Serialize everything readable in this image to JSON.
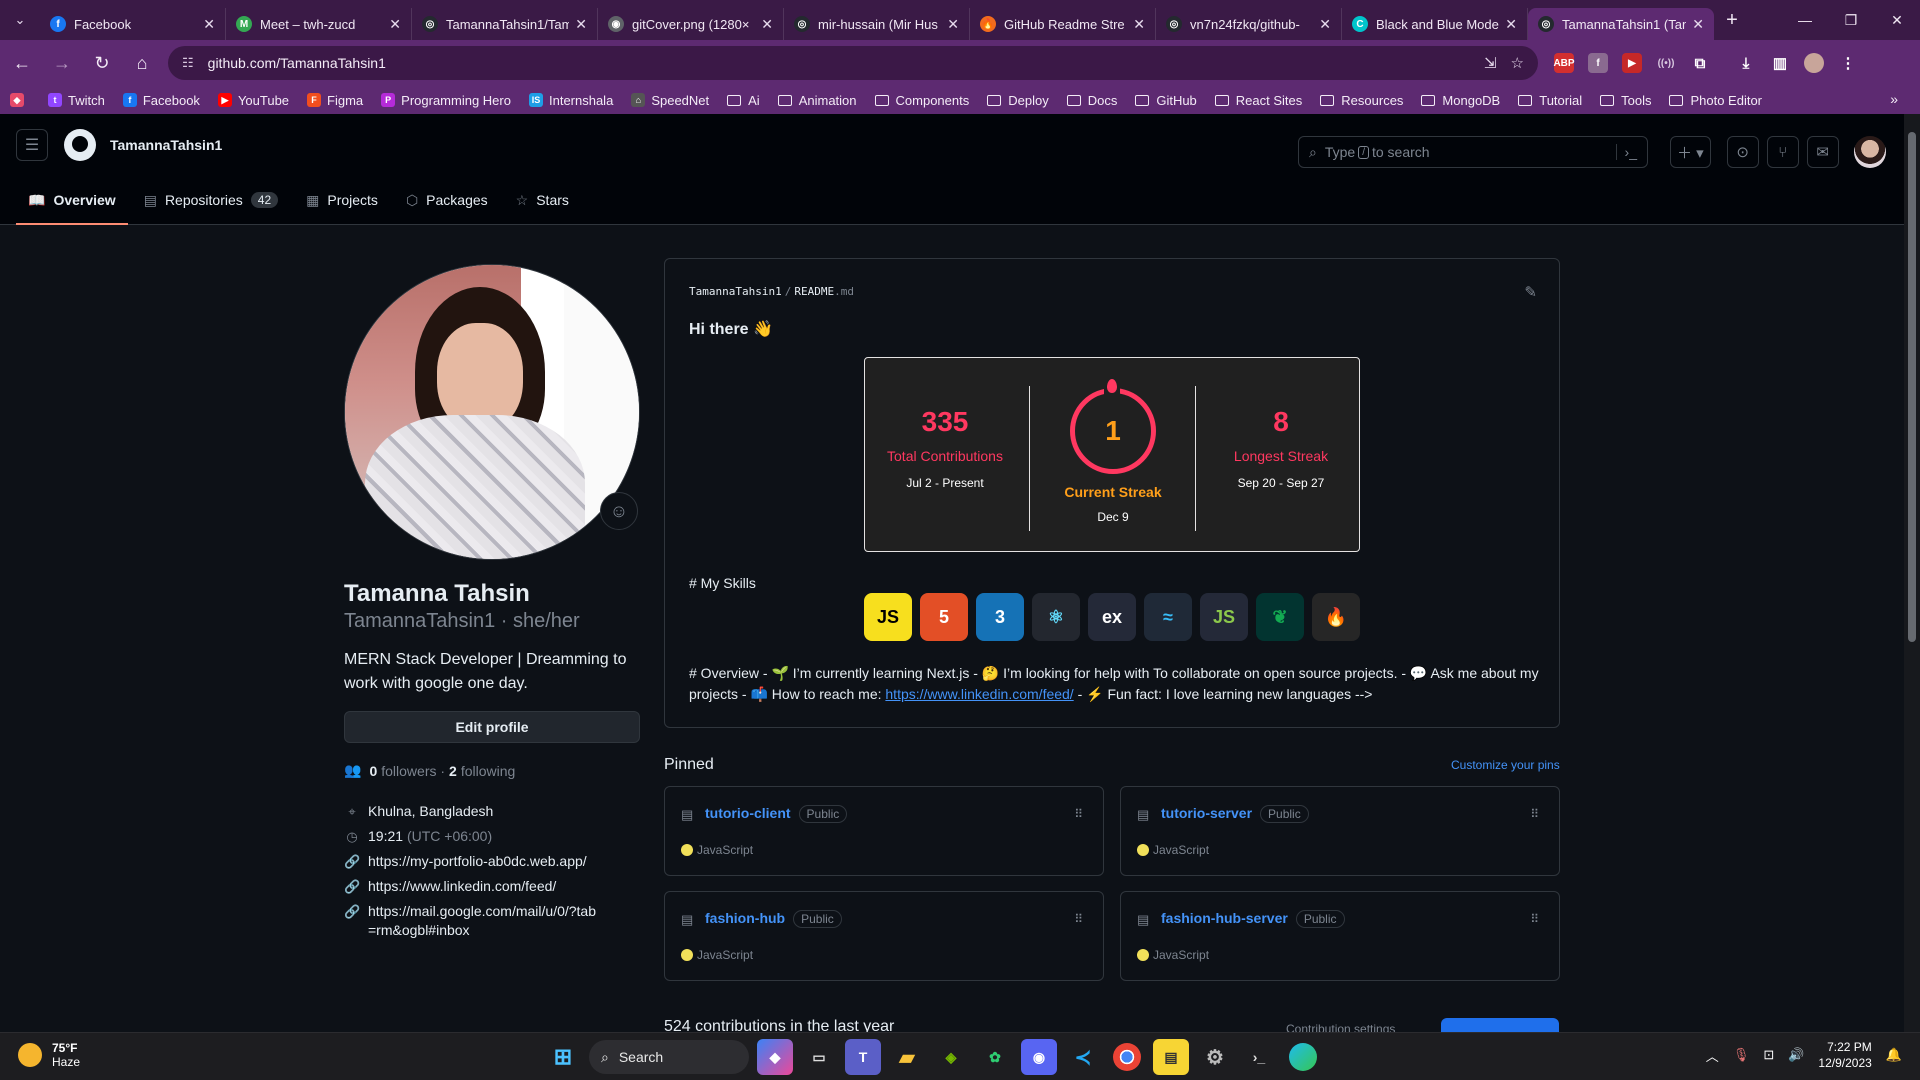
{
  "browser": {
    "tabs": [
      {
        "title": "Facebook",
        "color": "#1877f2",
        "glyph": "f"
      },
      {
        "title": "Meet – twh-zucd",
        "color": "#34a853",
        "glyph": "M"
      },
      {
        "title": "TamannaTahsin1/Tam",
        "color": "#24292f",
        "glyph": "◎"
      },
      {
        "title": "gitCover.png (1280×",
        "color": "#5f6368",
        "glyph": "◉"
      },
      {
        "title": "mir-hussain (Mir Hus",
        "color": "#24292f",
        "glyph": "◎"
      },
      {
        "title": "GitHub Readme Stre",
        "color": "#f26b1d",
        "glyph": "🔥"
      },
      {
        "title": "vn7n24fzkq/github-",
        "color": "#24292f",
        "glyph": "◎"
      },
      {
        "title": "Black and Blue Mode",
        "color": "#00c4cc",
        "glyph": "C"
      },
      {
        "title": "TamannaTahsin1 (Tam",
        "color": "#24292f",
        "glyph": "◎"
      }
    ],
    "url": "github.com/TamannaTahsin1",
    "bookmarks": [
      {
        "label": "Twitch",
        "type": "site",
        "color": "#9146ff",
        "glyph": "t"
      },
      {
        "label": "Facebook",
        "type": "site",
        "color": "#1877f2",
        "glyph": "f"
      },
      {
        "label": "YouTube",
        "type": "site",
        "color": "#ff0000",
        "glyph": "▶"
      },
      {
        "label": "Figma",
        "type": "site",
        "color": "#f24e1e",
        "glyph": "F"
      },
      {
        "label": "Programming Hero",
        "type": "site",
        "color": "#b52bd8",
        "glyph": "P"
      },
      {
        "label": "Internshala",
        "type": "site",
        "color": "#1e9ee6",
        "glyph": "IS"
      },
      {
        "label": "SpeedNet",
        "type": "site",
        "color": "#555555",
        "glyph": "⌂"
      },
      {
        "label": "Ai",
        "type": "folder"
      },
      {
        "label": "Animation",
        "type": "folder"
      },
      {
        "label": "Components",
        "type": "folder"
      },
      {
        "label": "Deploy",
        "type": "folder"
      },
      {
        "label": "Docs",
        "type": "folder"
      },
      {
        "label": "GitHub",
        "type": "folder"
      },
      {
        "label": "React Sites",
        "type": "folder"
      },
      {
        "label": "Resources",
        "type": "folder"
      },
      {
        "label": "MongoDB",
        "type": "folder"
      },
      {
        "label": "Tutorial",
        "type": "folder"
      },
      {
        "label": "Tools",
        "type": "folder"
      },
      {
        "label": "Photo Editor",
        "type": "folder"
      }
    ]
  },
  "github": {
    "username": "TamannaTahsin1",
    "search_placeholder_before": "Type",
    "search_key": "/",
    "search_placeholder_after": "to search",
    "tabs": [
      {
        "label": "Overview",
        "icon": "book-icon",
        "glyph": "📖"
      },
      {
        "label": "Repositories",
        "icon": "repo-icon",
        "glyph": "▤",
        "count": "42"
      },
      {
        "label": "Projects",
        "icon": "table-icon",
        "glyph": "▦"
      },
      {
        "label": "Packages",
        "icon": "package-icon",
        "glyph": "⬡"
      },
      {
        "label": "Stars",
        "icon": "star-icon",
        "glyph": "☆"
      }
    ]
  },
  "profile": {
    "name": "Tamanna Tahsin",
    "login_pronouns": "TamannaTahsin1 · she/her",
    "bio": "MERN Stack Developer | Dreamming to work with google one day.",
    "edit_label": "Edit profile",
    "followers": "0",
    "followers_label": "followers ·",
    "following": "2",
    "following_label": "following",
    "location": "Khulna, Bangladesh",
    "time": "19:21",
    "timezone": "(UTC +06:00)",
    "links": [
      "https://my-portfolio-ab0dc.web.app/",
      "https://www.linkedin.com/feed/",
      "https://mail.google.com/mail/u/0/?tab=rm&ogbl#inbox"
    ]
  },
  "readme": {
    "owner": "TamannaTahsin1",
    "separator": "/",
    "file_name": "README",
    "file_ext": ".md",
    "greeting": "Hi there 👋",
    "streak": {
      "total": "335",
      "total_label": "Total Contributions",
      "total_range": "Jul 2 - Present",
      "current": "1",
      "current_label": "Current Streak",
      "current_range": "Dec 9",
      "longest": "8",
      "longest_label": "Longest Streak",
      "longest_range": "Sep 20 - Sep 27",
      "colors": {
        "background": "#202020",
        "accent": "#ff3860",
        "current": "#ff9f1a"
      }
    },
    "skills_heading": "# My Skills",
    "skills": [
      {
        "name": "JavaScript",
        "text": "JS",
        "bg": "#f7df1e",
        "fg": "#000000",
        "icon": "javascript-icon"
      },
      {
        "name": "HTML5",
        "text": "5",
        "bg": "#e34f26",
        "fg": "#ffffff",
        "icon": "html5-icon"
      },
      {
        "name": "CSS3",
        "text": "3",
        "bg": "#1572b6",
        "fg": "#ffffff",
        "icon": "css3-icon"
      },
      {
        "name": "React",
        "text": "⚛",
        "bg": "#23272f",
        "fg": "#61dafb",
        "icon": "react-icon"
      },
      {
        "name": "Express",
        "text": "ex",
        "bg": "#242938",
        "fg": "#ffffff",
        "icon": "express-icon"
      },
      {
        "name": "Tailwind",
        "text": "≈",
        "bg": "#1f2937",
        "fg": "#38bdf8",
        "icon": "tailwind-icon"
      },
      {
        "name": "Node.js",
        "text": "JS",
        "bg": "#242938",
        "fg": "#8cc84b",
        "icon": "nodejs-icon"
      },
      {
        "name": "MongoDB",
        "text": "❦",
        "bg": "#023430",
        "fg": "#13aa52",
        "icon": "mongodb-icon"
      },
      {
        "name": "Firebase",
        "text": "🔥",
        "bg": "#262626",
        "fg": "#ffca28",
        "icon": "firebase-icon"
      }
    ],
    "overview_before": "# Overview - 🌱 I’m currently learning Next.js - 🤔 I’m looking for help with To collaborate on open source projects. - 💬 Ask me about my projects - 📫 How to reach me:",
    "overview_link": "https://www.linkedin.com/feed/",
    "overview_after": "- ⚡ Fun fact: I love learning new languages -->"
  },
  "pinned": {
    "heading": "Pinned",
    "customize": "Customize your pins",
    "repos": [
      {
        "name": "tutorio-client",
        "visibility": "Public",
        "language": "JavaScript"
      },
      {
        "name": "tutorio-server",
        "visibility": "Public",
        "language": "JavaScript"
      },
      {
        "name": "fashion-hub",
        "visibility": "Public",
        "language": "JavaScript"
      },
      {
        "name": "fashion-hub-server",
        "visibility": "Public",
        "language": "JavaScript"
      }
    ]
  },
  "contributions": {
    "heading": "524 contributions in the last year",
    "settings": "Contribution settings"
  },
  "taskbar": {
    "temp": "75°F",
    "condition": "Haze",
    "search": "Search",
    "time": "7:22 PM",
    "date": "12/9/2023"
  }
}
